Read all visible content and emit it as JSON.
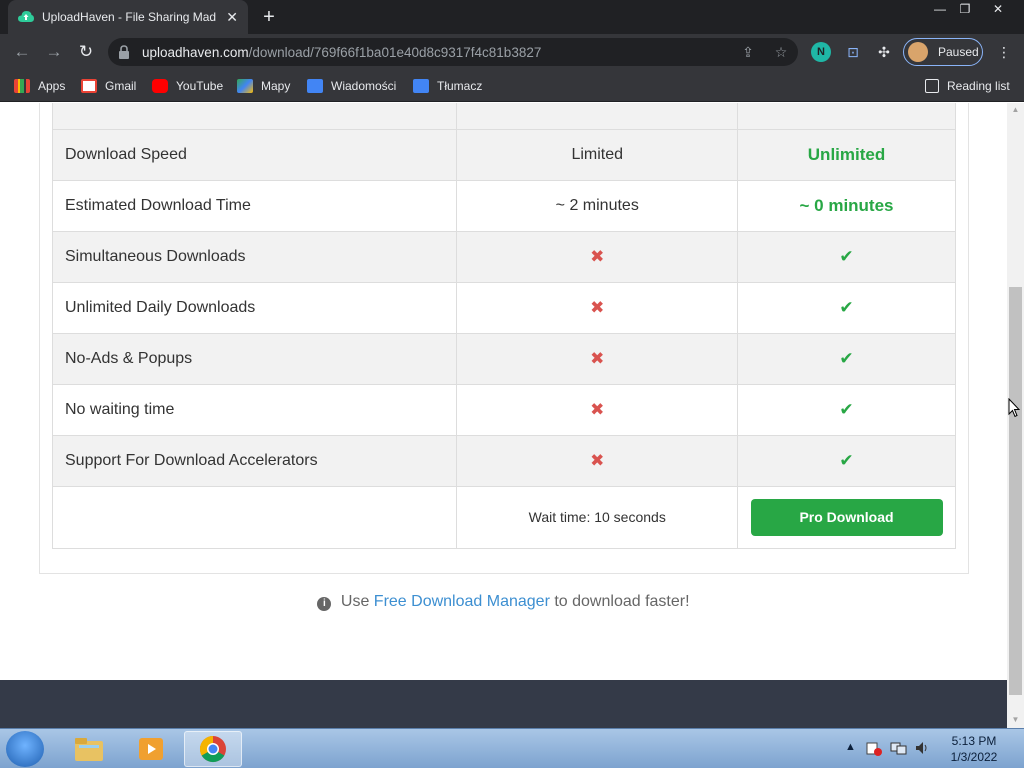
{
  "browser": {
    "tab_title": "UploadHaven - File Sharing Mad",
    "tab_close": "✕",
    "new_tab": "+",
    "url_host": "uploadhaven.com",
    "url_path": "/download/769f66f1ba01e40d8c9317f4c81b3827",
    "profile_label": "Paused",
    "ext_label": "N",
    "bookmarks": [
      "Apps",
      "Gmail",
      "YouTube",
      "Mapy",
      "Wiadomości",
      "Tłumacz"
    ],
    "reading_list": "Reading list"
  },
  "comparison": {
    "rows": [
      {
        "label": "Download Speed",
        "free": "Limited",
        "pro": "Unlimited"
      },
      {
        "label": "Estimated Download Time",
        "free": "~ 2 minutes",
        "pro": "~ 0 minutes"
      },
      {
        "label": "Simultaneous Downloads",
        "free": "✖",
        "pro": "✔"
      },
      {
        "label": "Unlimited Daily Downloads",
        "free": "✖",
        "pro": "✔"
      },
      {
        "label": "No-Ads & Popups",
        "free": "✖",
        "pro": "✔"
      },
      {
        "label": "No waiting time",
        "free": "✖",
        "pro": "✔"
      },
      {
        "label": "Support For Download Accelerators",
        "free": "✖",
        "pro": "✔"
      }
    ],
    "wait_text": "Wait time: 10 seconds",
    "pro_button": "Pro Download"
  },
  "tip": {
    "prefix": "Use",
    "link": "Free Download Manager",
    "suffix": "to download faster!"
  },
  "taskbar": {
    "time": "5:13 PM",
    "date": "1/3/2022"
  },
  "colors": {
    "accent_green": "#28a745",
    "cross_red": "#d9534f",
    "link_blue": "#3d8fd1"
  }
}
